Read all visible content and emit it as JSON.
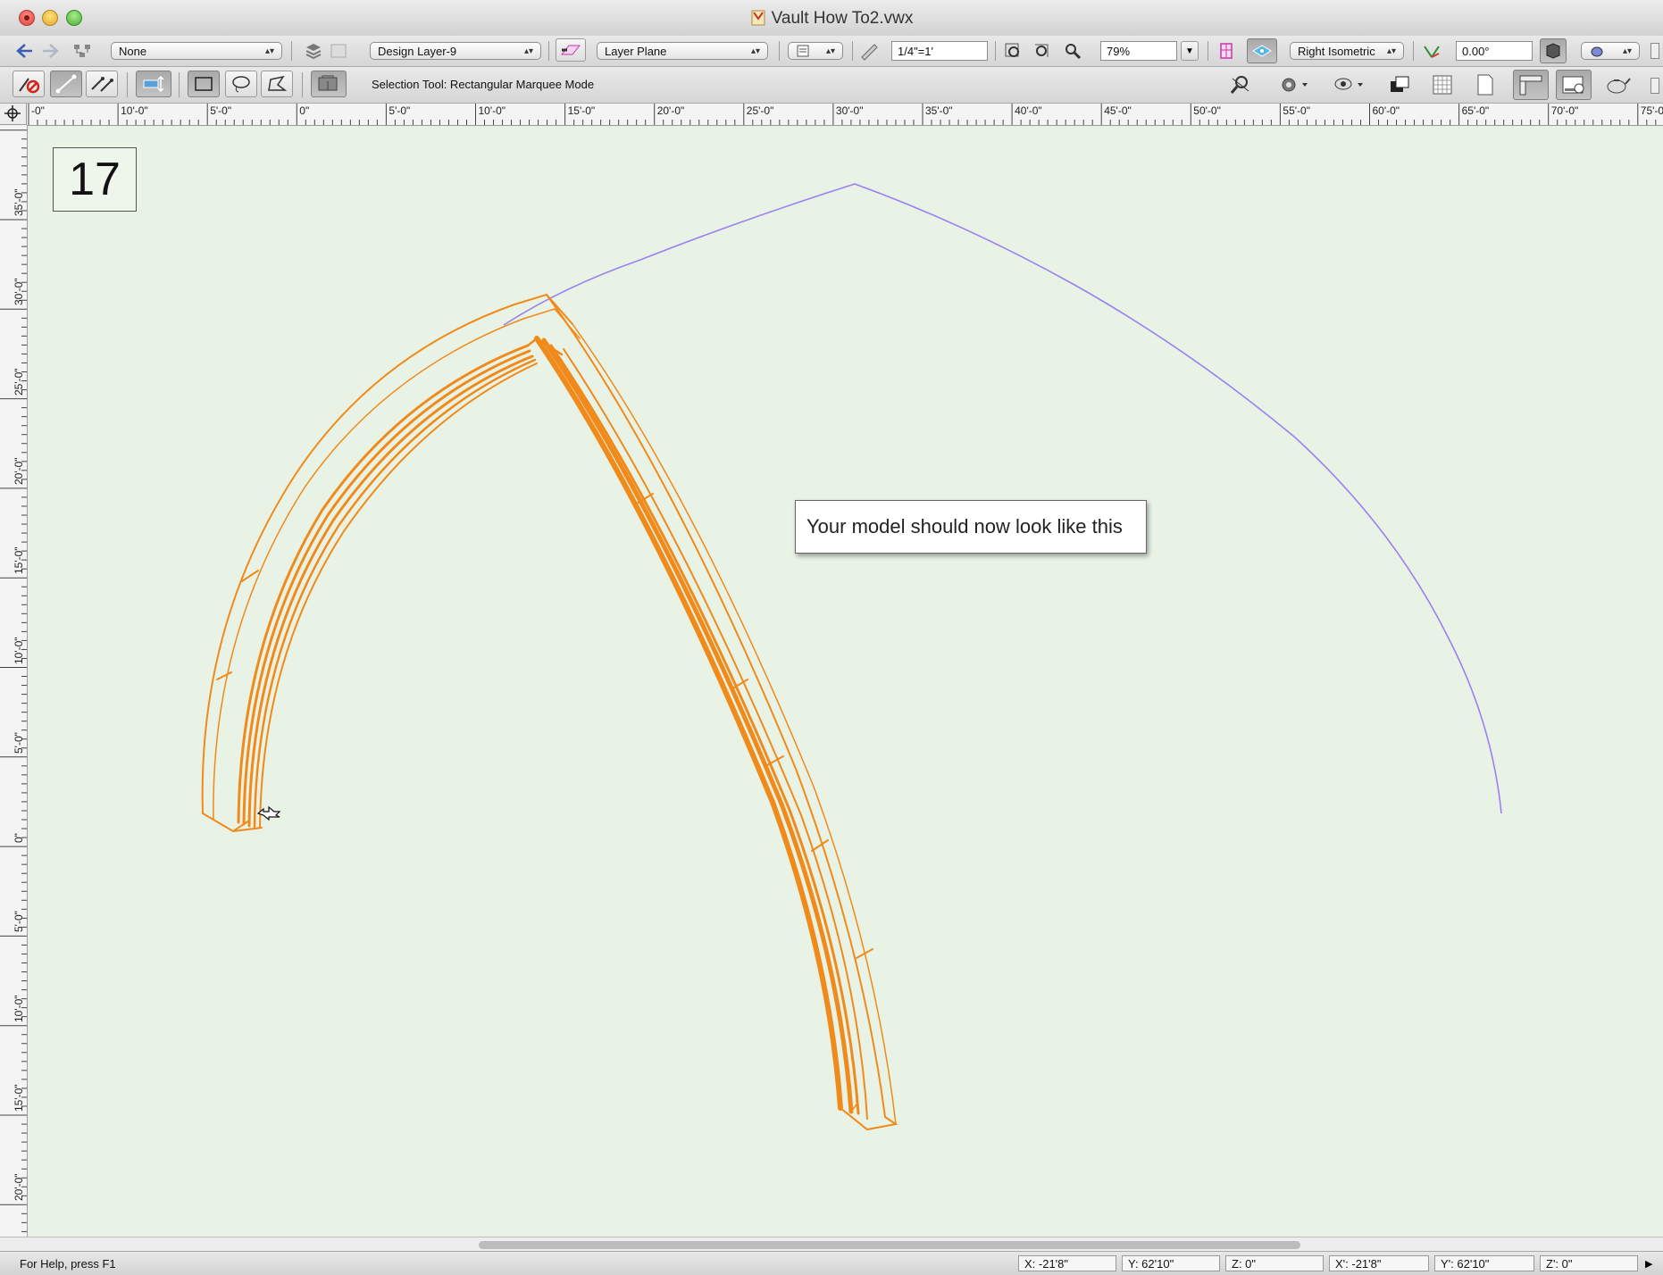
{
  "window": {
    "title": "Vault How To2.vwx"
  },
  "toolbar1": {
    "class_popup": "None",
    "layer_popup": "Design Layer-9",
    "plane_popup": "Layer Plane",
    "scale_field": "1/4\"=1'",
    "zoom_field": "79%",
    "view_popup": "Right Isometric",
    "rotation_field": "0.00°"
  },
  "toolbar2": {
    "mode_text": "Selection Tool: Rectangular Marquee Mode"
  },
  "rulers": {
    "horizontal": [
      "-0\"",
      "10'-0\"",
      "5'-0\"",
      "0\"",
      "5'-0\"",
      "10'-0\"",
      "15'-0\"",
      "20'-0\"",
      "25'-0\"",
      "30'-0\"",
      "35'-0\"",
      "40'-0\"",
      "45'-0\"",
      "50'-0\"",
      "55'-0\"",
      "60'-0\"",
      "65'-0\"",
      "70'-0\"",
      "75'-0\""
    ],
    "vertical": [
      "35'-0\"",
      "30'-0\"",
      "25'-0\"",
      "20'-0\"",
      "15'-0\"",
      "10'-0\"",
      "5'-0\"",
      "0\"",
      "5'-0\"",
      "10'-0\"",
      "15'-0\"",
      "20'-0\""
    ]
  },
  "canvas": {
    "step_number": "17",
    "callout": "Your model should now look like this",
    "arch_color": "#f08a1a",
    "guide_curve_color": "#9a80f0",
    "background_color": "#e8f3e6"
  },
  "statusbar": {
    "help": "For Help, press F1",
    "x": "X:  -21'8\"",
    "y": "Y:  62'10\"",
    "z": "Z:  0\"",
    "xp": "X':  -21'8\"",
    "yp": "Y':  62'10\"",
    "zp": "Z':  0\""
  }
}
